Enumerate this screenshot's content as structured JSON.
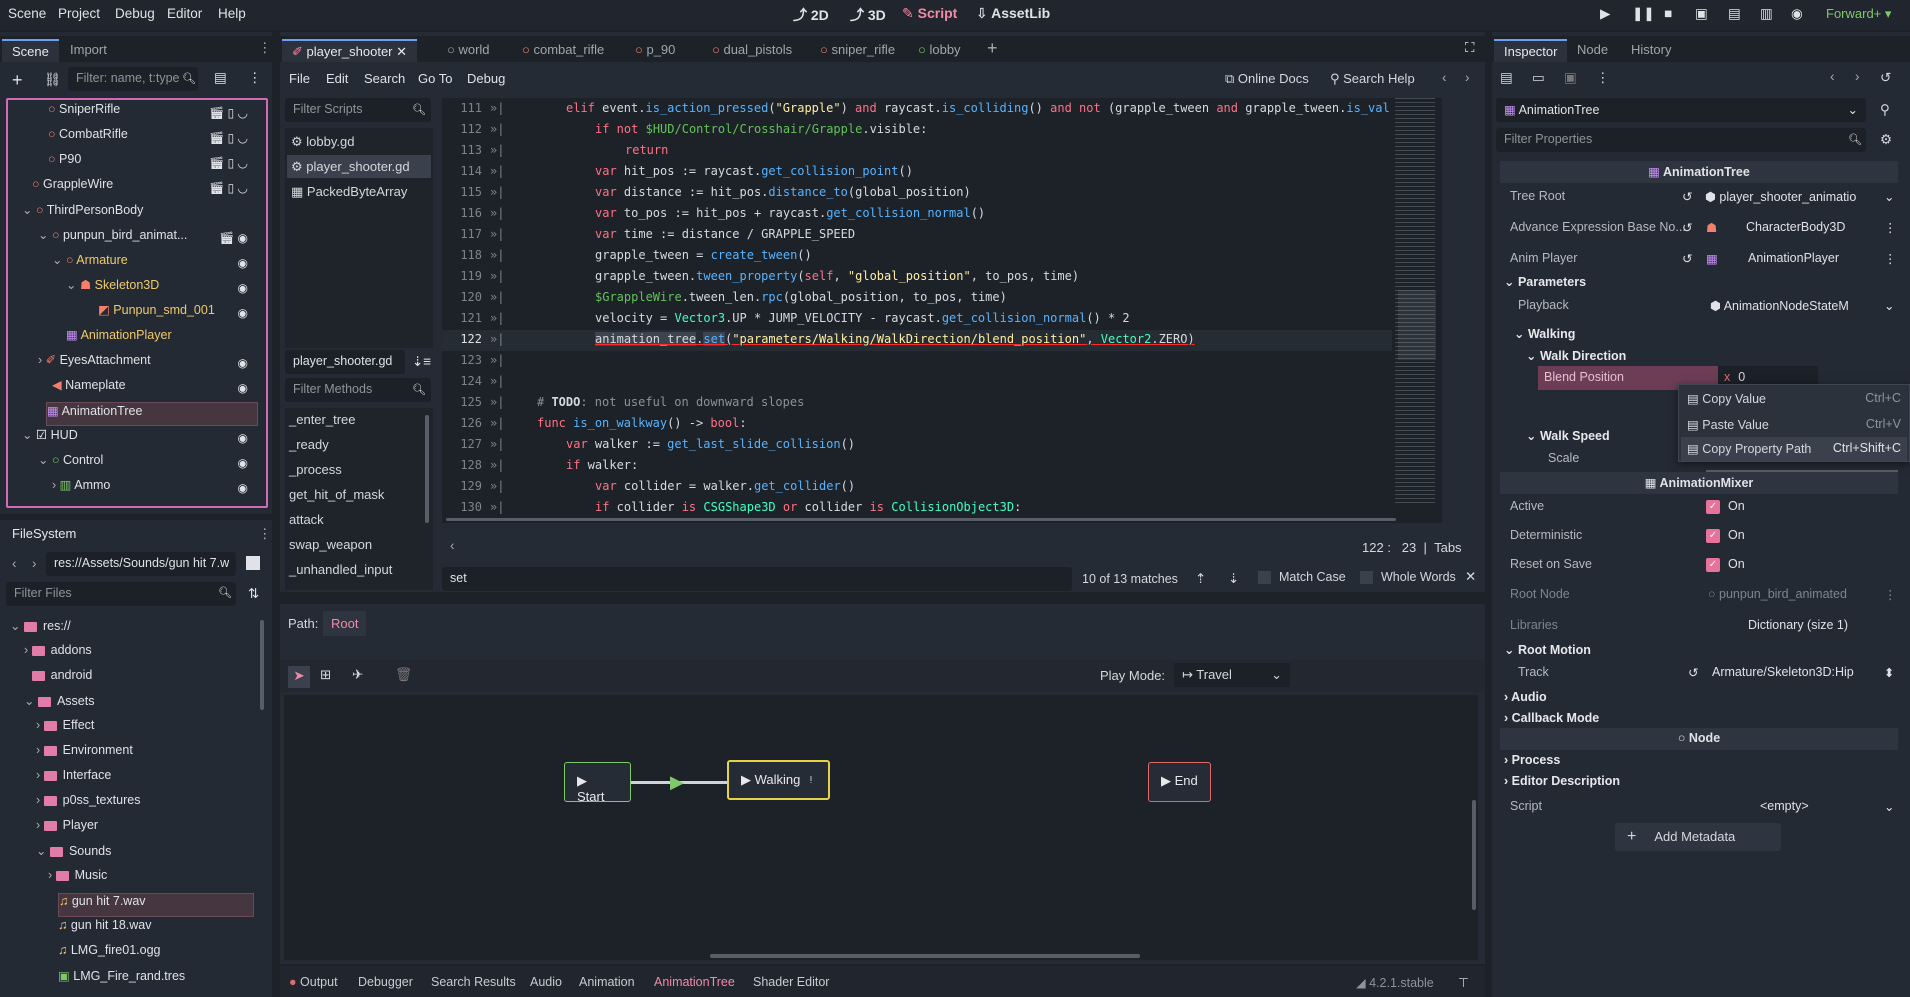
{
  "menu": [
    "Scene",
    "Project",
    "Debug",
    "Editor",
    "Help"
  ],
  "workspaces": {
    "d2": "2D",
    "d3": "3D",
    "script": "Script",
    "assetlib": "AssetLib"
  },
  "renderer": "Forward+",
  "scene_dock": {
    "tabs": [
      "Scene",
      "Import"
    ],
    "filter_placeholder": "Filter: name, t:type",
    "tree": [
      {
        "label": "SniperRifle"
      },
      {
        "label": "CombatRifle"
      },
      {
        "label": "P90"
      },
      {
        "label": "GrappleWire"
      },
      {
        "label": "ThirdPersonBody"
      },
      {
        "label": "punpun_bird_animat..."
      },
      {
        "label": "Armature"
      },
      {
        "label": "Skeleton3D"
      },
      {
        "label": "Punpun_smd_001"
      },
      {
        "label": "AnimationPlayer"
      },
      {
        "label": "EyesAttachment"
      },
      {
        "label": "Nameplate"
      },
      {
        "label": "AnimationTree"
      },
      {
        "label": "HUD"
      },
      {
        "label": "Control"
      },
      {
        "label": "Ammo"
      }
    ]
  },
  "filesystem": {
    "title": "FileSystem",
    "path": "res://Assets/Sounds/gun hit 7.w",
    "filter_placeholder": "Filter Files",
    "items": [
      {
        "label": "res://"
      },
      {
        "label": "addons"
      },
      {
        "label": "android"
      },
      {
        "label": "Assets"
      },
      {
        "label": "Effect"
      },
      {
        "label": "Environment"
      },
      {
        "label": "Interface"
      },
      {
        "label": "p0ss_textures"
      },
      {
        "label": "Player"
      },
      {
        "label": "Sounds"
      },
      {
        "label": "Music"
      },
      {
        "label": "gun hit 7.wav"
      },
      {
        "label": "gun hit 18.wav"
      },
      {
        "label": "LMG_fire01.ogg"
      },
      {
        "label": "LMG_Fire_rand.tres"
      }
    ]
  },
  "script_tabs": [
    "player_shooter",
    "world",
    "combat_rifle",
    "p_90",
    "dual_pistols",
    "sniper_rifle",
    "lobby"
  ],
  "script_menu": [
    "File",
    "Edit",
    "Search",
    "Go To",
    "Debug"
  ],
  "online_docs": "Online Docs",
  "search_help": "Search Help",
  "filter_scripts": "Filter Scripts",
  "scripts": [
    "lobby.gd",
    "player_shooter.gd",
    "PackedByteArray"
  ],
  "current_script": "player_shooter.gd",
  "filter_methods": "Filter Methods",
  "methods": [
    "_enter_tree",
    "_ready",
    "_process",
    "get_hit_of_mask",
    "attack",
    "swap_weapon",
    "_unhandled_input"
  ],
  "line_numbers": [
    "111",
    "112",
    "113",
    "114",
    "115",
    "116",
    "117",
    "118",
    "119",
    "120",
    "121",
    "122",
    "123",
    "124",
    "125",
    "126",
    "127",
    "128",
    "129",
    "130"
  ],
  "cursor": {
    "line": "122",
    "sep": ":",
    "col": "23",
    "indent": "Tabs"
  },
  "search": {
    "query": "set",
    "matches": "10 of 13 matches",
    "match_case": "Match Case",
    "whole_words": "Whole Words"
  },
  "anim_tree": {
    "path_label": "Path:",
    "path_value": "Root",
    "play_mode_label": "Play Mode:",
    "play_mode": "Travel",
    "nodes": {
      "start": "Start",
      "walking": "Walking",
      "end": "End"
    }
  },
  "bottom_tabs": [
    "Output",
    "Debugger",
    "Search Results",
    "Audio",
    "Animation",
    "AnimationTree",
    "Shader Editor"
  ],
  "version": "4.2.1.stable",
  "inspector": {
    "tabs": [
      "Inspector",
      "Node",
      "History"
    ],
    "node_name": "AnimationTree",
    "filter_placeholder": "Filter Properties",
    "class_header": "AnimationTree",
    "tree_root_label": "Tree Root",
    "tree_root_value": "player_shooter_animatio",
    "adv_expr_label": "Advance Expression Base No...",
    "adv_expr_value": "CharacterBody3D",
    "anim_player_label": "Anim Player",
    "anim_player_value": "AnimationPlayer",
    "parameters": "Parameters",
    "playback_label": "Playback",
    "playback_value": "AnimationNodeStateM",
    "walking": "Walking",
    "walk_direction": "Walk Direction",
    "blend_position": "Blend Position",
    "blend_x": "x",
    "blend_value": "0",
    "walk_speed": "Walk Speed",
    "scale": "Scale",
    "mixer_header": "AnimationMixer",
    "active_label": "Active",
    "deterministic_label": "Deterministic",
    "reset_label": "Reset on Save",
    "on": "On",
    "root_node_label": "Root Node",
    "root_node_value": "punpun_bird_animated",
    "libraries_label": "Libraries",
    "libraries_value": "Dictionary (size 1)",
    "root_motion": "Root Motion",
    "track_label": "Track",
    "track_value": "Armature/Skeleton3D:Hip",
    "audio": "Audio",
    "callback": "Callback Mode",
    "node_header": "Node",
    "process": "Process",
    "editor_desc": "Editor Description",
    "script_label": "Script",
    "script_value": "<empty>",
    "add_metadata": "Add Metadata"
  },
  "context_menu": [
    {
      "label": "Copy Value",
      "shortcut": "Ctrl+C"
    },
    {
      "label": "Paste Value",
      "shortcut": "Ctrl+V"
    },
    {
      "label": "Copy Property Path",
      "shortcut": "Ctrl+Shift+C"
    }
  ]
}
